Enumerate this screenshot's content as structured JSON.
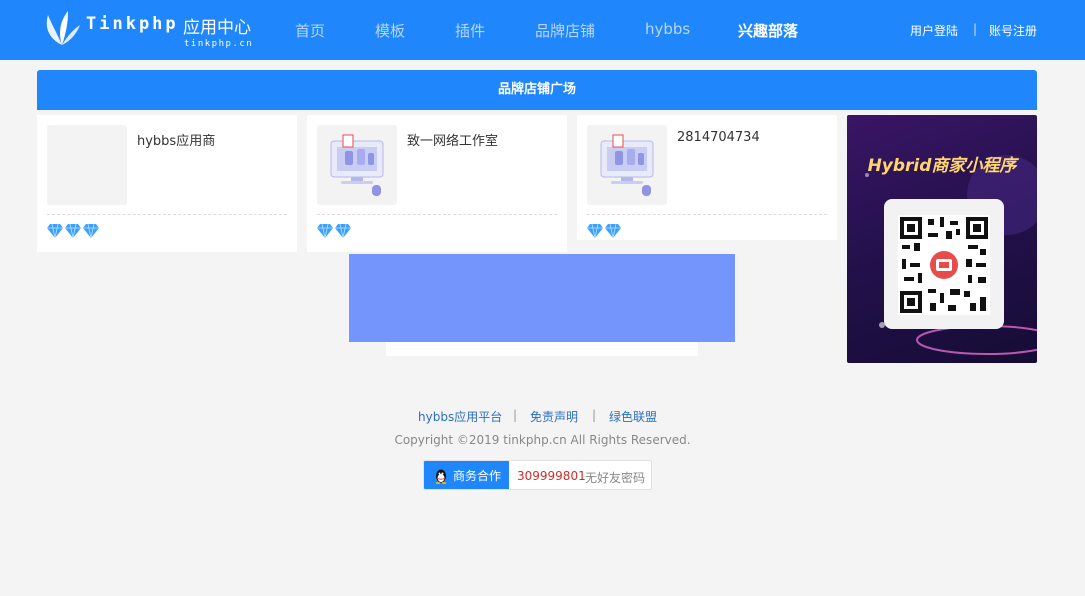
{
  "header": {
    "logo_word": "Tinkphp",
    "logo_cn": "应用中心",
    "logo_domain": "tinkphp.cn",
    "nav": [
      "首页",
      "模板",
      "插件",
      "品牌店铺",
      "hybbs",
      "兴趣部落"
    ],
    "login": "用户登陆",
    "separator": "|",
    "register": "账号注册"
  },
  "section": {
    "title": "品牌店铺广场"
  },
  "shops": [
    {
      "name": "hybbs应用商",
      "rating": 3
    },
    {
      "name": "致一网络工作室",
      "rating": 2
    },
    {
      "name": "2814704734",
      "rating": 2
    }
  ],
  "promo": {
    "title": "Hybrid商家小程序",
    "qr_icon": "qr-code-icon"
  },
  "footer": {
    "links": [
      "hybbs应用平台",
      "免责声明",
      "绿色联盟"
    ],
    "copyright": "Copyright ©2019 tinkphp.cn All Rights Reserved.",
    "coop_label": "商务合作",
    "coop_number": "309999801",
    "coop_note": "无好友密码"
  },
  "colors": {
    "brand": "#1f87fb",
    "ad_block": "#7395fc",
    "gem": "#3aa0ff",
    "promo_title": "#ffd66b"
  }
}
